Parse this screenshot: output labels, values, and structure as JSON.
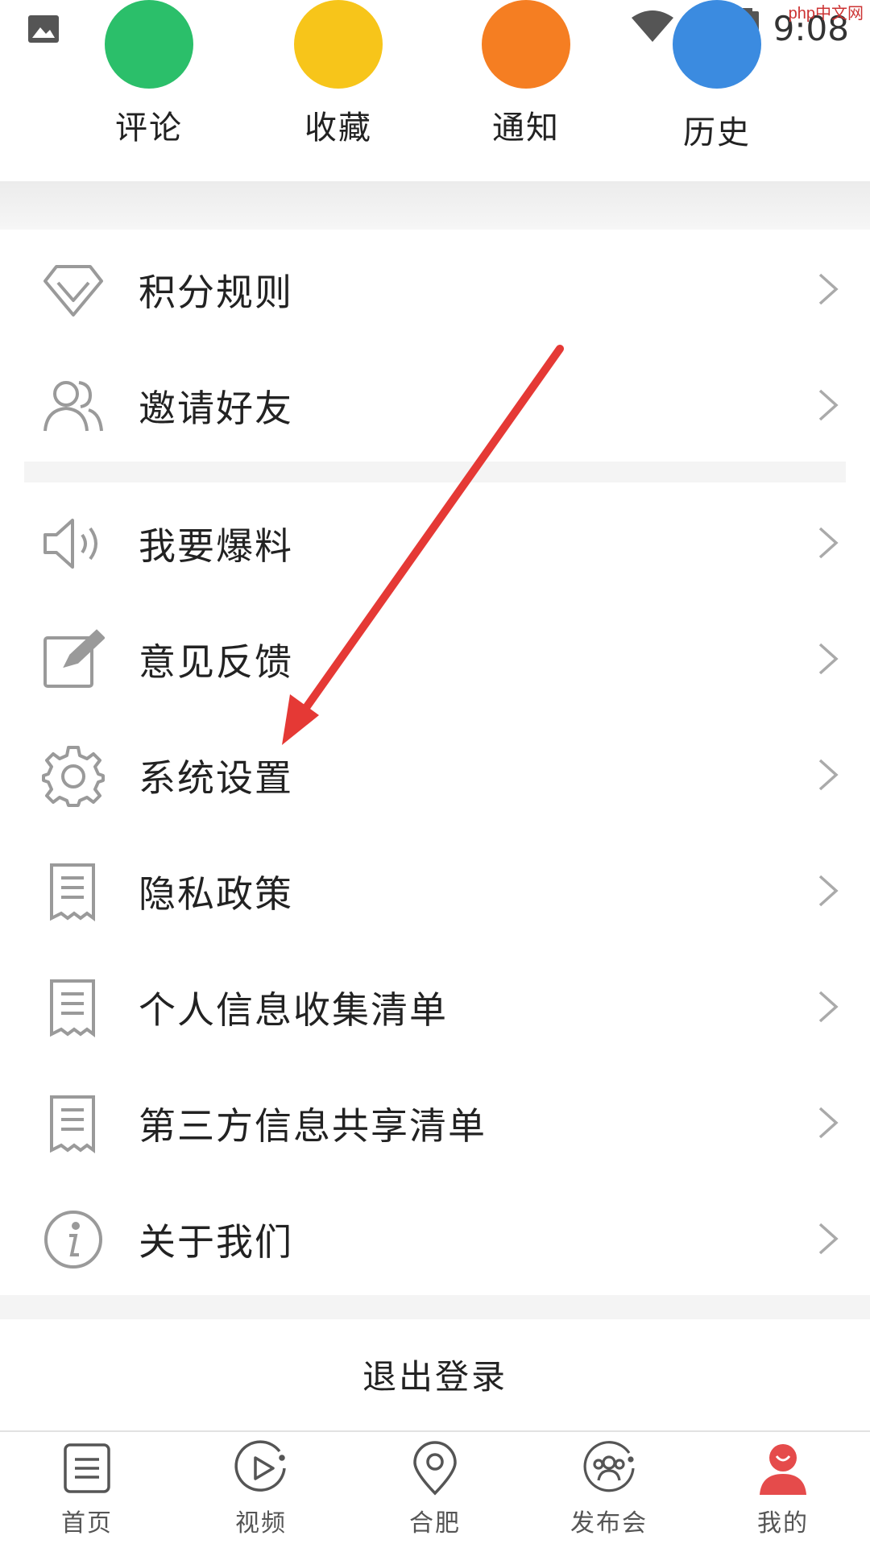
{
  "status_bar": {
    "time": "9:08",
    "icons": [
      "image-icon",
      "wifi-icon",
      "no-sim-icon",
      "battery-charging-icon"
    ]
  },
  "watermark": "php中文网",
  "quick_actions": [
    {
      "label": "评论",
      "color": "#2bbf6a",
      "icon": "comment-icon"
    },
    {
      "label": "收藏",
      "color": "#f7c51a",
      "icon": "favorite-icon"
    },
    {
      "label": "通知",
      "color": "#f57e22",
      "icon": "notification-icon"
    },
    {
      "label": "历史",
      "color": "#3b8be0",
      "icon": "history-icon"
    }
  ],
  "menu_group_1": [
    {
      "label": "积分规则",
      "icon": "diamond-icon"
    },
    {
      "label": "邀请好友",
      "icon": "users-icon"
    }
  ],
  "menu_group_2": [
    {
      "label": "我要爆料",
      "icon": "megaphone-icon"
    },
    {
      "label": "意见反馈",
      "icon": "edit-icon"
    },
    {
      "label": "系统设置",
      "icon": "gear-icon"
    },
    {
      "label": "隐私政策",
      "icon": "document-icon"
    },
    {
      "label": "个人信息收集清单",
      "icon": "document-icon"
    },
    {
      "label": "第三方信息共享清单",
      "icon": "document-icon"
    },
    {
      "label": "关于我们",
      "icon": "info-icon"
    }
  ],
  "logout_label": "退出登录",
  "tabs": [
    {
      "label": "首页",
      "icon": "home-list-icon",
      "active": false
    },
    {
      "label": "视频",
      "icon": "play-icon",
      "active": false
    },
    {
      "label": "合肥",
      "icon": "location-pin-icon",
      "active": false
    },
    {
      "label": "发布会",
      "icon": "group-icon",
      "active": false
    },
    {
      "label": "我的",
      "icon": "profile-icon",
      "active": true
    }
  ],
  "colors": {
    "icon_gray": "#9a9a9a",
    "accent_red": "#e54b4b",
    "arrow_red": "#e53935"
  }
}
